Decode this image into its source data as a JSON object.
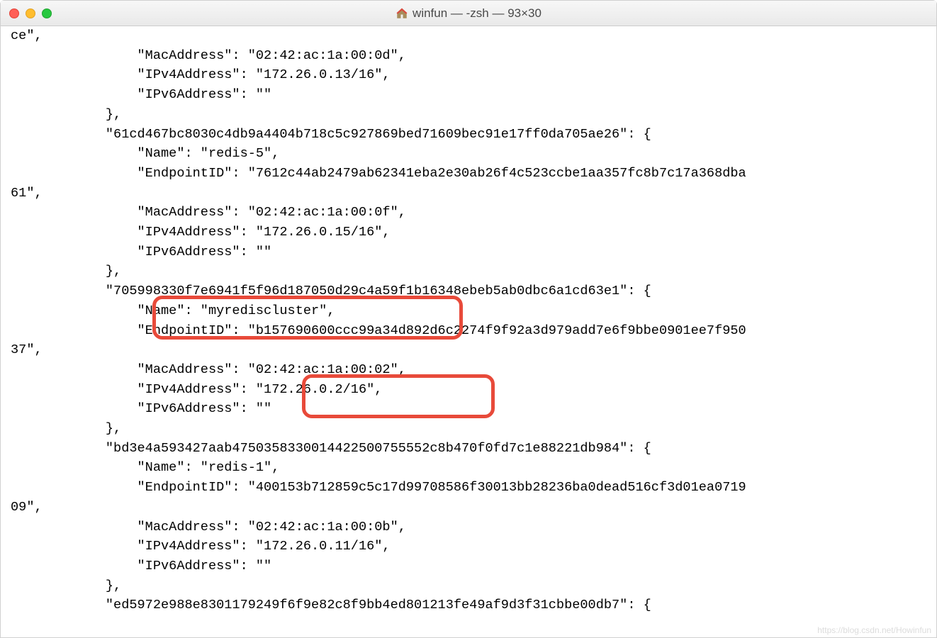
{
  "window": {
    "title": "winfun — -zsh — 93×30"
  },
  "terminal": {
    "lines": [
      "ce\",",
      "                \"MacAddress\": \"02:42:ac:1a:00:0d\",",
      "                \"IPv4Address\": \"172.26.0.13/16\",",
      "                \"IPv6Address\": \"\"",
      "            },",
      "            \"61cd467bc8030c4db9a4404b718c5c927869bed71609bec91e17ff0da705ae26\": {",
      "                \"Name\": \"redis-5\",",
      "                \"EndpointID\": \"7612c44ab2479ab62341eba2e30ab26f4c523ccbe1aa357fc8b7c17a368dba",
      "61\",",
      "                \"MacAddress\": \"02:42:ac:1a:00:0f\",",
      "                \"IPv4Address\": \"172.26.0.15/16\",",
      "                \"IPv6Address\": \"\"",
      "            },",
      "            \"705998330f7e6941f5f96d187050d29c4a59f1b16348ebeb5ab0dbc6a1cd63e1\": {",
      "                \"Name\": \"myrediscluster\",",
      "                \"EndpointID\": \"b157690600ccc99a34d892d6c2274f9f92a3d979add7e6f9bbe0901ee7f950",
      "37\",",
      "                \"MacAddress\": \"02:42:ac:1a:00:02\",",
      "                \"IPv4Address\": \"172.26.0.2/16\",",
      "                \"IPv6Address\": \"\"",
      "            },",
      "            \"bd3e4a593427aab4750358330014422500755552c8b470f0fd7c1e88221db984\": {",
      "                \"Name\": \"redis-1\",",
      "                \"EndpointID\": \"400153b712859c5c17d99708586f30013bb28236ba0dead516cf3d01ea0719",
      "09\",",
      "                \"MacAddress\": \"02:42:ac:1a:00:0b\",",
      "                \"IPv4Address\": \"172.26.0.11/16\",",
      "                \"IPv6Address\": \"\"",
      "            },",
      "            \"ed5972e988e8301179249f6f9e82c8f9bb4ed801213fe49af9d3f31cbbe00db7\": {"
    ]
  },
  "watermark": "https://blog.csdn.net/Howinfun"
}
